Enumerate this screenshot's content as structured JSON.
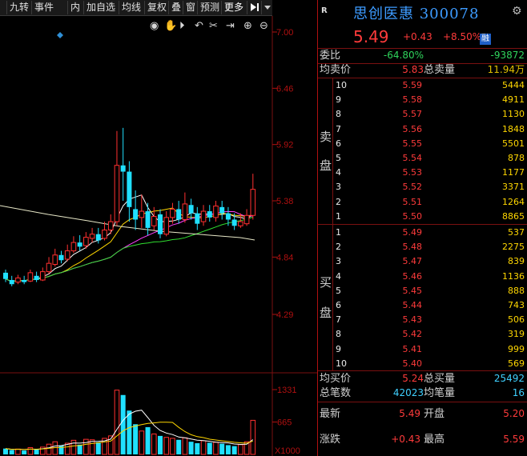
{
  "toolbar": {
    "items": [
      "九转",
      "事件",
      "内",
      "加自选",
      "均线",
      "复权",
      "叠",
      "窗",
      "预测",
      "更多"
    ],
    "prev_icon": "calendar-icon",
    "next_icon": "play-end-icon",
    "dropdown_icon": "chevron-down-icon"
  },
  "chart_tools": [
    "eye-icon",
    "hand-icon",
    "play-icon",
    "undo-icon",
    "scissors-icon",
    "export-icon",
    "zoom-in-icon",
    "zoom-out-icon"
  ],
  "chart_data": {
    "type": "candlestick",
    "price_axis_labels": [
      "7.00",
      "6.46",
      "5.92",
      "5.38",
      "4.84",
      "4.29"
    ],
    "ylim": [
      4.29,
      7.0
    ],
    "volume_axis_labels": [
      "1331",
      "665",
      "X1000"
    ],
    "volume_ylim": [
      0,
      1331
    ],
    "candles": [
      {
        "o": 4.69,
        "c": 4.63,
        "h": 4.72,
        "l": 4.6
      },
      {
        "o": 4.62,
        "c": 4.58,
        "h": 4.66,
        "l": 4.56
      },
      {
        "o": 4.6,
        "c": 4.64,
        "h": 4.67,
        "l": 4.58
      },
      {
        "o": 4.62,
        "c": 4.6,
        "h": 4.66,
        "l": 4.58
      },
      {
        "o": 4.61,
        "c": 4.69,
        "h": 4.72,
        "l": 4.6
      },
      {
        "o": 4.66,
        "c": 4.62,
        "h": 4.7,
        "l": 4.6
      },
      {
        "o": 4.62,
        "c": 4.7,
        "h": 4.74,
        "l": 4.61
      },
      {
        "o": 4.7,
        "c": 4.78,
        "h": 4.84,
        "l": 4.68
      },
      {
        "o": 4.77,
        "c": 4.86,
        "h": 4.92,
        "l": 4.75
      },
      {
        "o": 4.86,
        "c": 4.81,
        "h": 4.9,
        "l": 4.78
      },
      {
        "o": 4.82,
        "c": 4.9,
        "h": 4.96,
        "l": 4.8
      },
      {
        "o": 4.9,
        "c": 4.98,
        "h": 5.04,
        "l": 4.88
      },
      {
        "o": 4.98,
        "c": 4.94,
        "h": 5.05,
        "l": 4.9
      },
      {
        "o": 4.95,
        "c": 5.03,
        "h": 5.08,
        "l": 4.92
      },
      {
        "o": 5.02,
        "c": 5.06,
        "h": 5.12,
        "l": 4.98
      },
      {
        "o": 5.06,
        "c": 5.0,
        "h": 5.12,
        "l": 4.97
      },
      {
        "o": 5.02,
        "c": 5.1,
        "h": 5.18,
        "l": 5.0
      },
      {
        "o": 5.1,
        "c": 5.18,
        "h": 5.25,
        "l": 5.06
      },
      {
        "o": 5.18,
        "c": 5.72,
        "h": 6.05,
        "l": 5.14
      },
      {
        "o": 5.72,
        "c": 5.66,
        "h": 6.08,
        "l": 5.38
      },
      {
        "o": 5.66,
        "c": 5.32,
        "h": 5.76,
        "l": 5.18
      },
      {
        "o": 5.3,
        "c": 5.2,
        "h": 5.48,
        "l": 5.1
      },
      {
        "o": 5.22,
        "c": 5.28,
        "h": 5.44,
        "l": 5.12
      },
      {
        "o": 5.28,
        "c": 5.12,
        "h": 5.36,
        "l": 5.05
      },
      {
        "o": 5.14,
        "c": 5.23,
        "h": 5.32,
        "l": 5.1
      },
      {
        "o": 5.25,
        "c": 5.06,
        "h": 5.3,
        "l": 5.02
      },
      {
        "o": 5.06,
        "c": 5.22,
        "h": 5.28,
        "l": 5.04
      },
      {
        "o": 5.22,
        "c": 5.3,
        "h": 5.36,
        "l": 5.16
      },
      {
        "o": 5.3,
        "c": 5.2,
        "h": 5.38,
        "l": 5.16
      },
      {
        "o": 5.2,
        "c": 5.35,
        "h": 5.46,
        "l": 5.17
      },
      {
        "o": 5.34,
        "c": 5.26,
        "h": 5.4,
        "l": 5.2
      },
      {
        "o": 5.26,
        "c": 5.16,
        "h": 5.32,
        "l": 5.1
      },
      {
        "o": 5.18,
        "c": 5.28,
        "h": 5.34,
        "l": 5.14
      },
      {
        "o": 5.28,
        "c": 5.22,
        "h": 5.34,
        "l": 5.18
      },
      {
        "o": 5.22,
        "c": 5.33,
        "h": 5.38,
        "l": 5.18
      },
      {
        "o": 5.32,
        "c": 5.26,
        "h": 5.38,
        "l": 5.2
      },
      {
        "o": 5.26,
        "c": 5.2,
        "h": 5.32,
        "l": 5.14
      },
      {
        "o": 5.2,
        "c": 5.14,
        "h": 5.26,
        "l": 5.1
      },
      {
        "o": 5.14,
        "c": 5.18,
        "h": 5.26,
        "l": 5.12
      },
      {
        "o": 5.16,
        "c": 5.24,
        "h": 5.3,
        "l": 5.14
      },
      {
        "o": 5.24,
        "c": 5.49,
        "h": 5.64,
        "l": 5.2
      }
    ],
    "volumes": [
      120,
      90,
      110,
      80,
      140,
      100,
      150,
      210,
      260,
      180,
      230,
      290,
      200,
      310,
      300,
      250,
      330,
      380,
      1320,
      1220,
      900,
      620,
      480,
      560,
      420,
      380,
      350,
      330,
      300,
      340,
      260,
      230,
      280,
      240,
      250,
      220,
      190,
      170,
      200,
      260,
      700
    ]
  },
  "quote": {
    "r_label": "R",
    "name": "思创医惠",
    "code": "300078",
    "price": "5.49",
    "change": "+0.43",
    "change_pct": "+8.50%",
    "margin_badge": "融",
    "settings_icon": "gear-icon",
    "wei_bi_label": "委比",
    "wei_bi_pct": "-64.80%",
    "wei_bi_val": "-93872",
    "avg_sell_label": "均卖价",
    "avg_sell": "5.83",
    "total_sell_label": "总卖量",
    "total_sell": "11.94万",
    "sell_side_label": [
      "卖",
      "盘"
    ],
    "sells": [
      {
        "idx": "10",
        "price": "5.59",
        "vol": "5444"
      },
      {
        "idx": "9",
        "price": "5.58",
        "vol": "4911"
      },
      {
        "idx": "8",
        "price": "5.57",
        "vol": "1130"
      },
      {
        "idx": "7",
        "price": "5.56",
        "vol": "1848"
      },
      {
        "idx": "6",
        "price": "5.55",
        "vol": "5501"
      },
      {
        "idx": "5",
        "price": "5.54",
        "vol": "878"
      },
      {
        "idx": "4",
        "price": "5.53",
        "vol": "1177"
      },
      {
        "idx": "3",
        "price": "5.52",
        "vol": "3371"
      },
      {
        "idx": "2",
        "price": "5.51",
        "vol": "1264"
      },
      {
        "idx": "1",
        "price": "5.50",
        "vol": "8865"
      }
    ],
    "buy_side_label": [
      "买",
      "盘"
    ],
    "buys": [
      {
        "idx": "1",
        "price": "5.49",
        "vol": "537"
      },
      {
        "idx": "2",
        "price": "5.48",
        "vol": "2275"
      },
      {
        "idx": "3",
        "price": "5.47",
        "vol": "839"
      },
      {
        "idx": "4",
        "price": "5.46",
        "vol": "1136"
      },
      {
        "idx": "5",
        "price": "5.45",
        "vol": "888"
      },
      {
        "idx": "6",
        "price": "5.44",
        "vol": "743"
      },
      {
        "idx": "7",
        "price": "5.43",
        "vol": "506"
      },
      {
        "idx": "8",
        "price": "5.42",
        "vol": "319"
      },
      {
        "idx": "9",
        "price": "5.41",
        "vol": "999"
      },
      {
        "idx": "10",
        "price": "5.40",
        "vol": "569"
      }
    ],
    "avg_buy_label": "均买价",
    "avg_buy": "5.24",
    "total_buy_label": "总买量",
    "total_buy": "25492",
    "total_trades_label": "总笔数",
    "total_trades": "42023",
    "avg_trade_label": "均笔量",
    "avg_trade": "16",
    "latest_label": "最新",
    "latest": "5.49",
    "open_label": "开盘",
    "open": "5.20",
    "change_label": "涨跌",
    "change2": "+0.43",
    "high_label": "最高",
    "high": "5.59"
  }
}
